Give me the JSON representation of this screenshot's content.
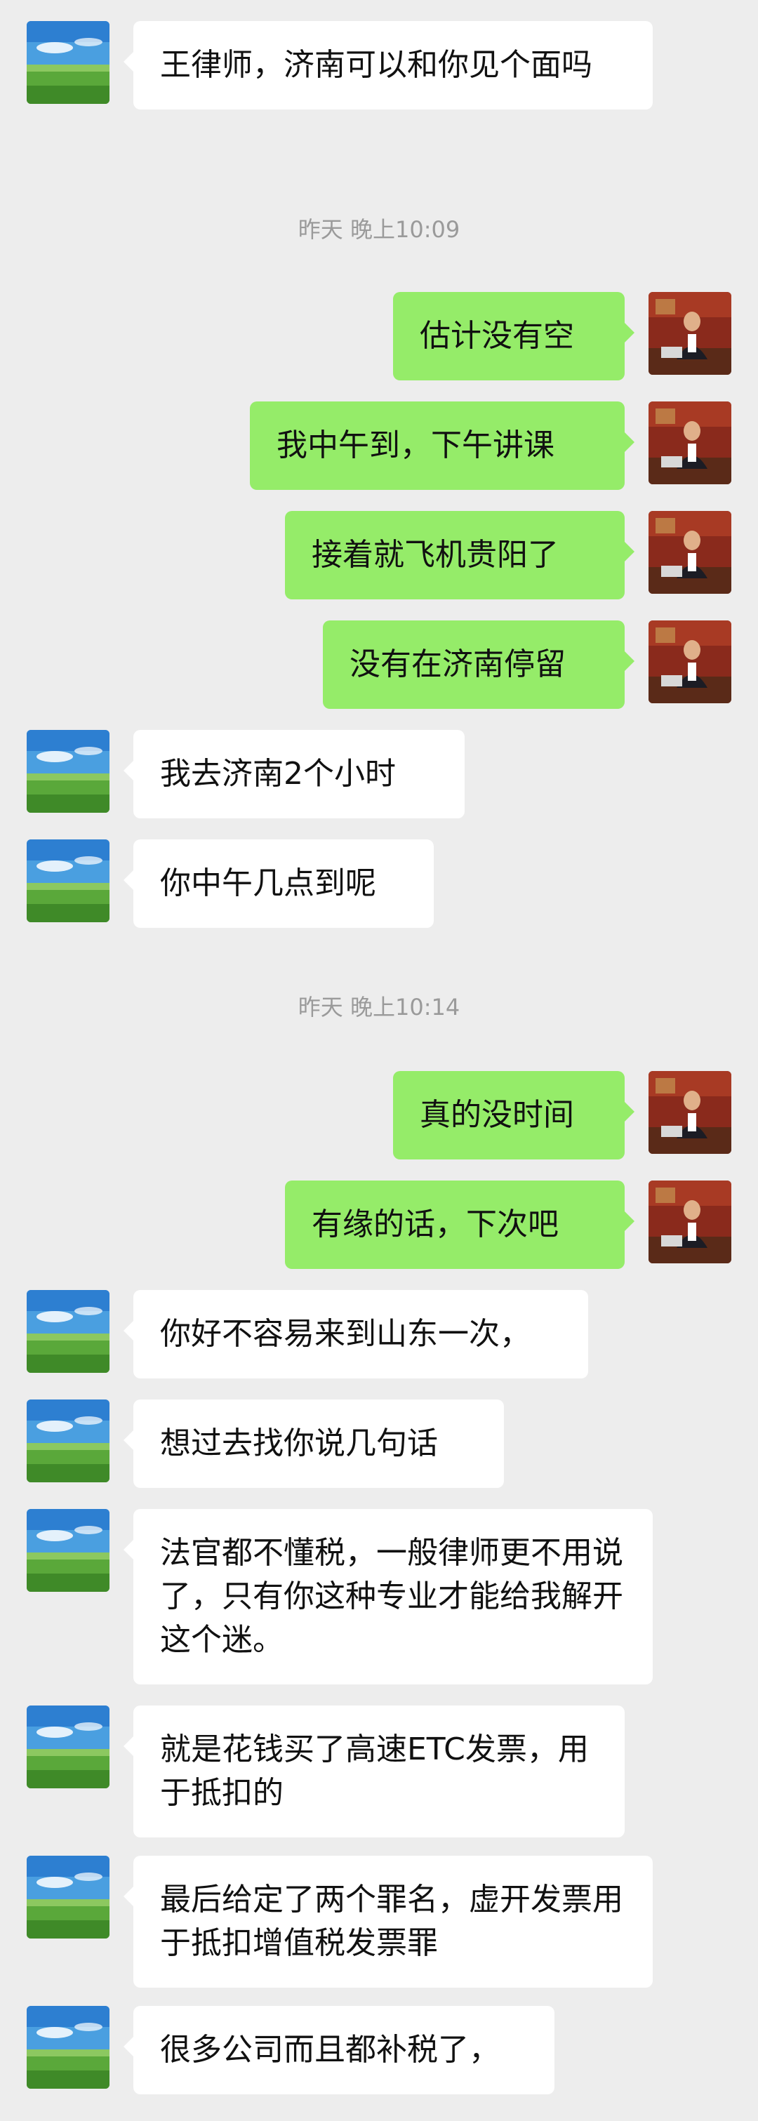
{
  "messages": [
    {
      "side": "left",
      "text": "王律师，济南可以和你见个面吗"
    },
    {
      "time": "昨天 晚上10:09"
    },
    {
      "side": "right",
      "text": "估计没有空"
    },
    {
      "side": "right",
      "text": "我中午到，下午讲课"
    },
    {
      "side": "right",
      "text": "接着就飞机贵阳了"
    },
    {
      "side": "right",
      "text": "没有在济南停留"
    },
    {
      "side": "left",
      "text": "我去济南2个小时"
    },
    {
      "side": "left",
      "text": "你中午几点到呢"
    },
    {
      "time": "昨天 晚上10:14"
    },
    {
      "side": "right",
      "text": "真的没时间"
    },
    {
      "side": "right",
      "text": "有缘的话，下次吧"
    },
    {
      "side": "left",
      "text": "你好不容易来到山东一次，"
    },
    {
      "side": "left",
      "text": "想过去找你说几句话"
    },
    {
      "side": "left",
      "text": "法官都不懂税，一般律师更不用说了，只有你这种专业才能给我解开这个迷。"
    },
    {
      "side": "left",
      "text": "就是花钱买了高速ETC发票，用于抵扣的"
    },
    {
      "side": "left",
      "text": "最后给定了两个罪名，虚开发票用于抵扣增值税发票罪"
    },
    {
      "side": "left",
      "text": "很多公司而且都补税了，"
    }
  ]
}
